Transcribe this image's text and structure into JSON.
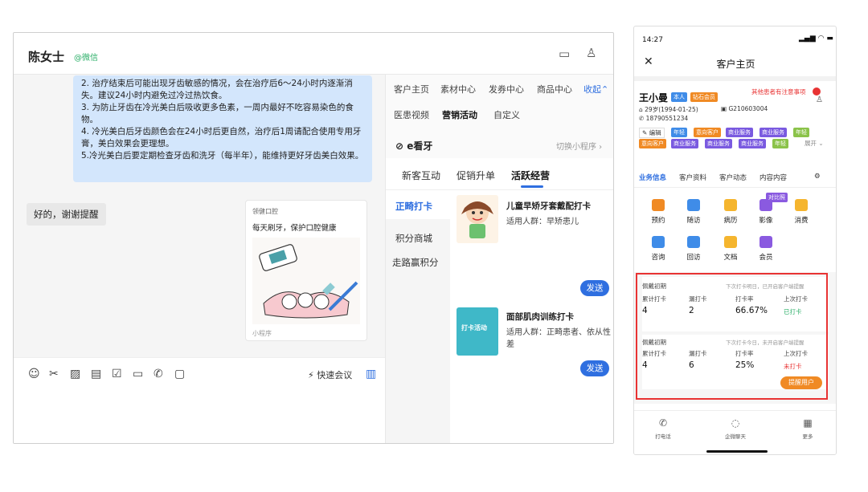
{
  "chat": {
    "name": "陈女士",
    "source": "@微信",
    "message_lines": [
      "2. 治疗结束后可能出现牙齿敏感的情况，会在治疗后6～24小时内逐渐消失。建议24小时内避免过冷过热饮食。",
      "3. 为防止牙齿在冷光美白后吸收更多色素，一周内最好不吃容易染色的食物。",
      "4. 冷光美白后牙齿颜色会在24小时后更自然，治疗后1周请配合使用专用牙膏，美白效果会更理想。",
      "5.冷光美白后要定期检查牙齿和洗牙（每半年），能维持更好牙齿美白效果。"
    ],
    "reply": "好的，谢谢提醒",
    "mini_program": {
      "brand": "领健口腔",
      "title": "每天刷牙，保护口腔健康",
      "footer": "小程序"
    },
    "quick_meeting": "快速会议"
  },
  "right_panel": {
    "tabs_row1": [
      "客户主页",
      "素材中心",
      "发券中心",
      "商品中心",
      "收起"
    ],
    "tabs_row2": [
      "医患视频",
      "营销活动",
      "自定义"
    ],
    "active_tab2": "营销活动",
    "app_name": "e看牙",
    "switch_label": "切换小程序",
    "sub_tabs": [
      "新客互动",
      "促销升单",
      "活跃经营"
    ],
    "side_items": [
      "正畸打卡",
      "积分商城",
      "走路赢积分"
    ],
    "products": [
      {
        "title": "儿童早矫牙套戴配打卡",
        "audience": "适用人群：早矫患儿",
        "button": "发送"
      },
      {
        "title": "面部肌肉训练打卡",
        "audience": "适用人群：正畸患者、依从性差",
        "button": "发送",
        "image_label": "打卡活动"
      }
    ]
  },
  "phone": {
    "time": "14:27",
    "page_title": "客户主页",
    "notice": "其他患者有注意事项",
    "patient_name": "王小曼",
    "tags_top": [
      "本人",
      "钻石会员"
    ],
    "age_birth": "29岁(1994-01-25)",
    "card_no": "G210603004",
    "phone_no": "18790551234",
    "edit_label": "编辑",
    "tags": [
      "年轻",
      "意向客户",
      "商业服务",
      "商业服务",
      "年轻",
      "意向客户",
      "商业服务",
      "商业服务",
      "商业服务",
      "年轻"
    ],
    "expand": "展开",
    "tabs": [
      "业务信息",
      "客户资料",
      "客户动态",
      "内容内容"
    ],
    "grid": [
      "预约",
      "随访",
      "病历",
      "影像",
      "消费",
      "咨询",
      "回访",
      "文档",
      "会员"
    ],
    "grid_badge": "对比照",
    "records": [
      {
        "phase": "佩戴初期",
        "hint": "下次打卡明日，已开启客户端提醒",
        "labels": [
          "累计打卡",
          "漏打卡",
          "打卡率",
          "上次打卡"
        ],
        "values": [
          "4",
          "2",
          "66.67%",
          "已打卡"
        ]
      },
      {
        "phase": "佩戴初期",
        "hint": "下次打卡今日，未开启客户端提醒",
        "labels": [
          "累计打卡",
          "漏打卡",
          "打卡率",
          "上次打卡"
        ],
        "values": [
          "4",
          "6",
          "25%",
          "未打卡"
        ]
      }
    ],
    "remind_button": "提醒用户",
    "nav": [
      "打电话",
      "企微聊天",
      "更多"
    ]
  },
  "colors": {
    "primary": "#2f6fe0",
    "green": "#2aae67",
    "red": "#e83333",
    "orange": "#f08a24"
  }
}
